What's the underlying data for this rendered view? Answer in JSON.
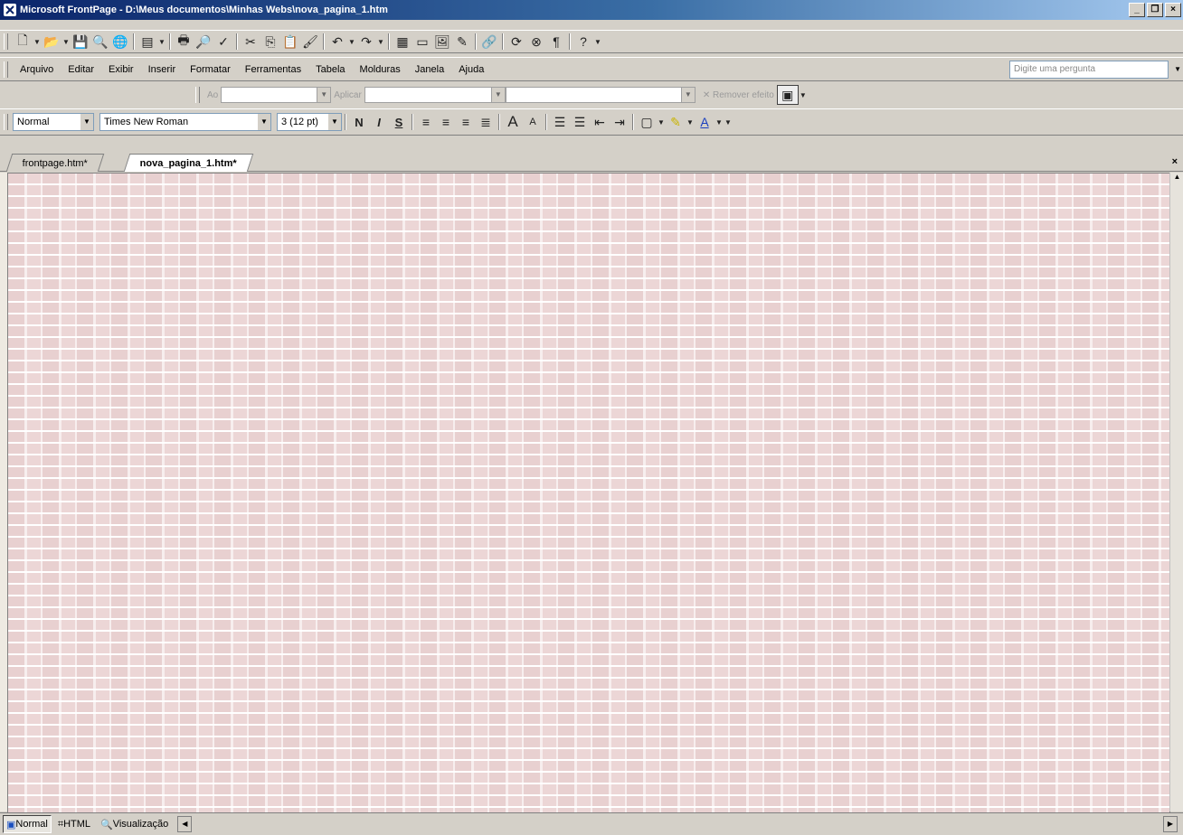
{
  "window": {
    "title": "Microsoft FrontPage - D:\\Meus documentos\\Minhas Webs\\nova_pagina_1.htm",
    "minimize": "_",
    "restore": "❐",
    "close": "×"
  },
  "menu": {
    "items": [
      "Arquivo",
      "Editar",
      "Exibir",
      "Inserir",
      "Formatar",
      "Ferramentas",
      "Tabela",
      "Molduras",
      "Janela",
      "Ajuda"
    ],
    "ask_placeholder": "Digite uma pergunta"
  },
  "dhtml": {
    "on_label": "Ao",
    "apply_label": "Aplicar",
    "remove_effect_label": "Remover efeito"
  },
  "format": {
    "style": "Normal",
    "font": "Times New Roman",
    "size": "3 (12 pt)",
    "bold": "N",
    "italic": "I",
    "underline": "S"
  },
  "tabs": [
    {
      "label": "frontpage.htm*",
      "active": false
    },
    {
      "label": "nova_pagina_1.htm*",
      "active": true
    }
  ],
  "views": [
    {
      "label": "Normal",
      "active": true
    },
    {
      "label": "HTML",
      "active": false
    },
    {
      "label": "Visualização",
      "active": false
    }
  ],
  "colors": {
    "titlebar_start": "#0a246a",
    "background_pattern": "#f3e9e9"
  }
}
